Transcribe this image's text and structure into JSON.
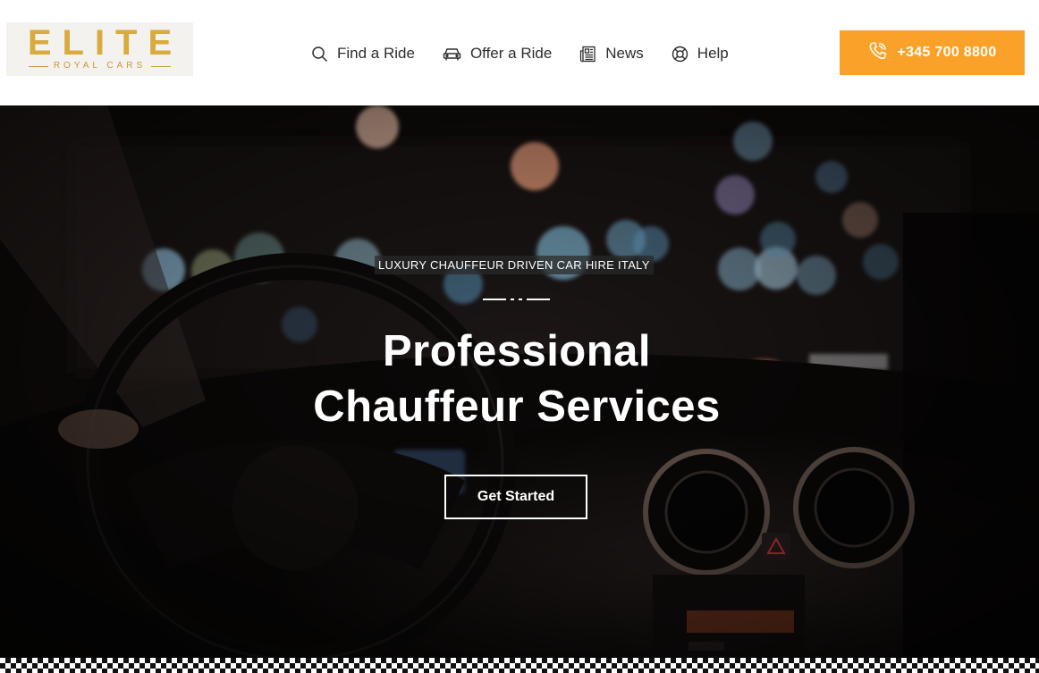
{
  "header": {
    "logo": {
      "main": "ELITE",
      "sub": "ROYAL CARS"
    },
    "nav": [
      {
        "label": "Find a Ride",
        "icon": "search-icon"
      },
      {
        "label": "Offer a Ride",
        "icon": "car-icon"
      },
      {
        "label": "News",
        "icon": "newspaper-icon"
      },
      {
        "label": "Help",
        "icon": "lifebuoy-icon"
      }
    ],
    "phone": {
      "label": "+345 700 8800",
      "icon": "phone-icon"
    }
  },
  "hero": {
    "kicker": "LUXURY CHAUFFEUR DRIVEN CAR HIRE ITALY",
    "headline_line1": "Professional",
    "headline_line2": "Chauffeur Services",
    "cta_label": "Get Started"
  },
  "colors": {
    "accent": "#f9a128",
    "logo_gold": "#d9aa3e",
    "nav_text": "#2d2d2d"
  }
}
